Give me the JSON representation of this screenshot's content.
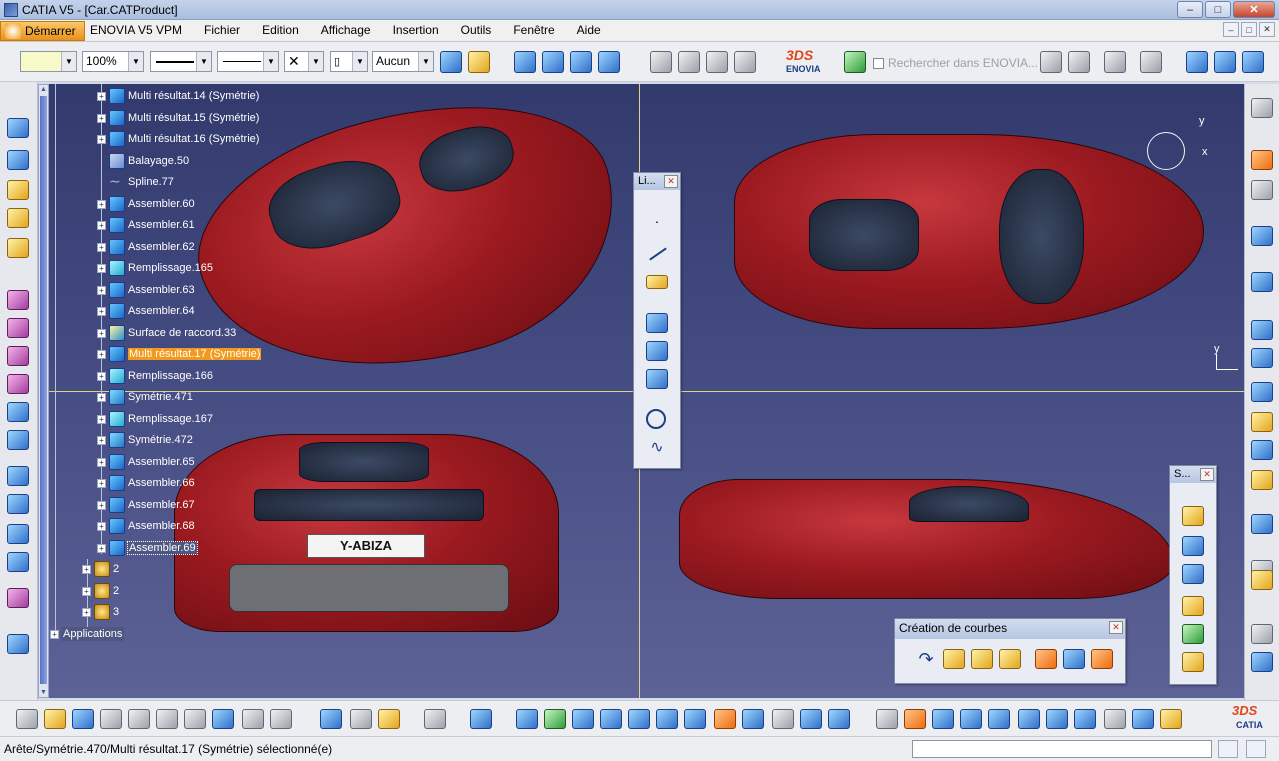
{
  "window": {
    "title": "CATIA V5 - [Car.CATProduct]",
    "buttons": [
      "–",
      "□",
      "✕"
    ]
  },
  "menubar": {
    "start": "Démarrer",
    "items": [
      "ENOVIA V5 VPM",
      "Fichier",
      "Edition",
      "Affichage",
      "Insertion",
      "Outils",
      "Fenêtre",
      "Aide"
    ],
    "mdi_buttons": [
      "–",
      "□",
      "✕"
    ]
  },
  "properties": {
    "color_value": "",
    "zoom": "100%",
    "layer": "Aucun",
    "search_placeholder": "Rechercher dans ENOVIA..."
  },
  "tree": {
    "items": [
      {
        "label": "Multi résultat.14 (Symétrie)",
        "icon": "multi-result-icon"
      },
      {
        "label": "Multi résultat.15 (Symétrie)",
        "icon": "multi-result-icon"
      },
      {
        "label": "Multi résultat.16 (Symétrie)",
        "icon": "multi-result-icon"
      },
      {
        "label": "Balayage.50",
        "icon": "sweep-icon"
      },
      {
        "label": "Spline.77",
        "icon": "spline-icon"
      },
      {
        "label": "Assembler.60",
        "icon": "join-icon"
      },
      {
        "label": "Assembler.61",
        "icon": "join-icon"
      },
      {
        "label": "Assembler.62",
        "icon": "join-icon"
      },
      {
        "label": "Remplissage.165",
        "icon": "fill-icon"
      },
      {
        "label": "Assembler.63",
        "icon": "join-icon"
      },
      {
        "label": "Assembler.64",
        "icon": "join-icon"
      },
      {
        "label": "Surface de raccord.33",
        "icon": "blend-icon"
      },
      {
        "label": "Multi résultat.17 (Symétrie)",
        "icon": "multi-result-icon",
        "state": "selected"
      },
      {
        "label": "Remplissage.166",
        "icon": "fill-icon"
      },
      {
        "label": "Symétrie.471",
        "icon": "symmetry-icon"
      },
      {
        "label": "Remplissage.167",
        "icon": "fill-icon"
      },
      {
        "label": "Symétrie.472",
        "icon": "symmetry-icon"
      },
      {
        "label": "Assembler.65",
        "icon": "join-icon"
      },
      {
        "label": "Assembler.66",
        "icon": "join-icon"
      },
      {
        "label": "Assembler.67",
        "icon": "join-icon"
      },
      {
        "label": "Assembler.68",
        "icon": "join-icon"
      },
      {
        "label": "Assembler.69",
        "icon": "join-icon",
        "state": "boxed"
      }
    ],
    "sub_products": [
      "2",
      "2",
      "3"
    ],
    "applications": "Applications"
  },
  "viewport": {
    "license_plate": "Y-ABIZA",
    "axis_labels": {
      "y1": "y",
      "x1": "x",
      "y2": "y"
    }
  },
  "floating_toolbars": {
    "wireframe_title": "Li...",
    "surfaces_title": "S...",
    "curves_title": "Création de courbes"
  },
  "statusbar": {
    "message": "Arête/Symétrie.470/Multi résultat.17 (Symétrie) sélectionné(e)"
  },
  "colors": {
    "selection": "#f29a1e",
    "viewport_top": "#323a6d",
    "viewport_bottom": "#5d6296",
    "car_red": "#9b1a20"
  }
}
